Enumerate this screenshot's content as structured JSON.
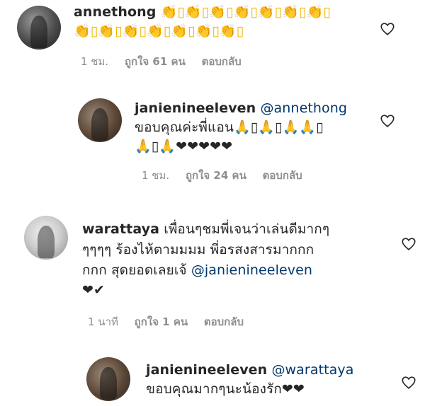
{
  "comments": [
    {
      "username": "annethong",
      "lines": [
        "👏▯👏▯👏▯👏▯👏▯👏▯👏▯",
        "👏▯👏▯👏▯👏▯👏▯👏▯👏▯"
      ],
      "time": "1 ชม.",
      "likes": "ถูกใจ 61 คน",
      "reply": "ตอบกลับ"
    },
    {
      "username": "janienineeleven",
      "mention": "@annethong",
      "lines": [
        "ขอบคุณค่ะพี่แอน🙏▯🙏▯🙏🙏▯",
        "🙏▯🙏❤❤❤❤❤"
      ],
      "time": "1 ชม.",
      "likes": "ถูกใจ 24 คน",
      "reply": "ตอบกลับ"
    },
    {
      "username": "warattaya",
      "lines": [
        "เพื่อนๆชมพี่เจนว่าเล่นดีมากๆ",
        "ๆๆๆๆ ร้องไห้ตามมมม พี่อรสงสารมากกก",
        "กกก สุดยอดเลยเจ้"
      ],
      "mention": "@janienineeleven",
      "last_line": "❤✔",
      "time": "1 นาที",
      "likes": "ถูกใจ 1 คน",
      "reply": "ตอบกลับ"
    },
    {
      "username": "janienineeleven",
      "mention": "@warattaya",
      "lines": [
        "ขอบคุณมากๆนะน้องรัก❤❤"
      ]
    }
  ]
}
